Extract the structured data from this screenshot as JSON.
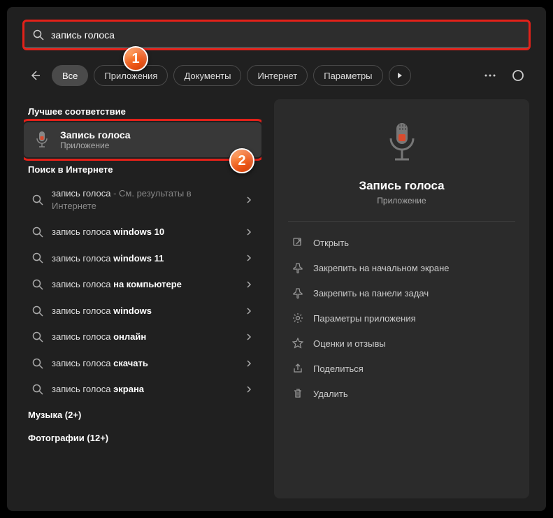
{
  "search": {
    "value": "запись голоса"
  },
  "filters": {
    "items": [
      {
        "label": "Все",
        "active": true
      },
      {
        "label": "Приложения",
        "active": false
      },
      {
        "label": "Документы",
        "active": false
      },
      {
        "label": "Интернет",
        "active": false
      },
      {
        "label": "Параметры",
        "active": false
      }
    ]
  },
  "sections": {
    "best_match": "Лучшее соответствие",
    "web_search": "Поиск в Интернете",
    "music": "Музыка (2+)",
    "photos": "Фотографии (12+)"
  },
  "best_match": {
    "title": "Запись голоса",
    "subtitle": "Приложение"
  },
  "web_results": [
    {
      "prefix": "запись голоса",
      "suffix_dim": " - См. результаты в Интернете",
      "bold": ""
    },
    {
      "prefix": "запись голоса ",
      "bold": "windows 10"
    },
    {
      "prefix": "запись голоса ",
      "bold": "windows 11"
    },
    {
      "prefix": "запись голоса ",
      "bold": "на компьютере"
    },
    {
      "prefix": "запись голоса ",
      "bold": "windows"
    },
    {
      "prefix": "запись голоса ",
      "bold": "онлайн"
    },
    {
      "prefix": "запись голоса ",
      "bold": "скачать"
    },
    {
      "prefix": "запись голоса ",
      "bold": "экрана"
    }
  ],
  "preview": {
    "title": "Запись голоса",
    "subtitle": "Приложение"
  },
  "actions": [
    {
      "icon": "open",
      "label": "Открыть"
    },
    {
      "icon": "pin-start",
      "label": "Закрепить на начальном экране"
    },
    {
      "icon": "pin-taskbar",
      "label": "Закрепить на панели задач"
    },
    {
      "icon": "settings",
      "label": "Параметры приложения"
    },
    {
      "icon": "star",
      "label": "Оценки и отзывы"
    },
    {
      "icon": "share",
      "label": "Поделиться"
    },
    {
      "icon": "trash",
      "label": "Удалить"
    }
  ],
  "badges": {
    "one": "1",
    "two": "2"
  },
  "colors": {
    "highlight": "#e32119",
    "badge_a": "#ff8a3d",
    "badge_b": "#e84e10"
  }
}
